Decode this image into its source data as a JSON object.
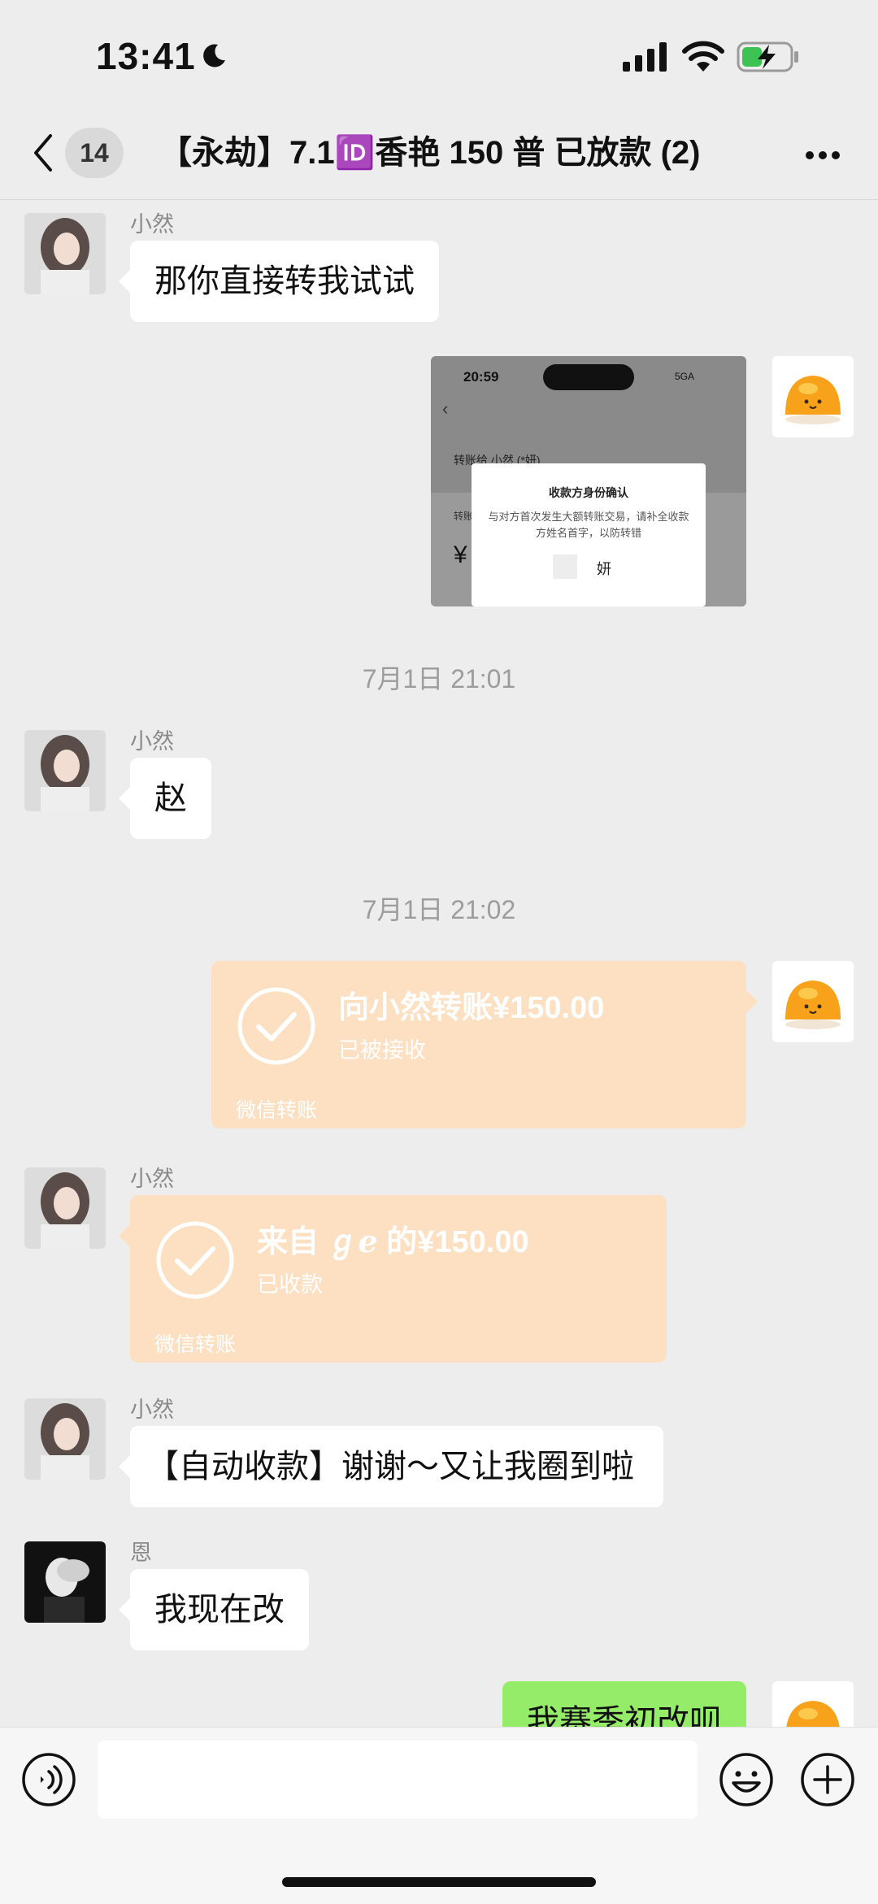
{
  "status_bar": {
    "time": "13:41"
  },
  "nav": {
    "badge": "14",
    "title": "【永劫】7.1🆔香艳 150 普 已放款 (2)"
  },
  "messages": {
    "m1": {
      "sender": "小然",
      "text": "那你直接转我试试"
    },
    "screenshot": {
      "time": "20:59",
      "signal_text": "5GA",
      "line1": "转账给 小然 (*妍)",
      "dialog_title": "收款方身份确认",
      "dialog_body": "与对方首次发生大额转账交易，请补全收款方姓名首字，以防转错",
      "char": "妍",
      "side1": "转账",
      "side2": "¥"
    },
    "ts1": "7月1日 21:01",
    "m2": {
      "sender": "小然",
      "text": "赵"
    },
    "ts2": "7月1日 21:02",
    "transfer_out": {
      "amount_text": "向小然转账¥150.00",
      "status": "已被接收",
      "footer": "微信转账"
    },
    "transfer_in": {
      "sender": "小然",
      "amount_text": "来自 ℊℯ 的¥150.00",
      "status": "已收款",
      "footer": "微信转账"
    },
    "m3": {
      "sender": "小然",
      "text": "【自动收款】谢谢～又让我圈到啦"
    },
    "m4": {
      "sender": "恩",
      "text": "我现在改"
    },
    "m5": {
      "text": "我赛季初改呗"
    }
  },
  "colors": {
    "background": "#ededed",
    "transfer": "#fde0c1",
    "outgoing": "#95ec69"
  }
}
